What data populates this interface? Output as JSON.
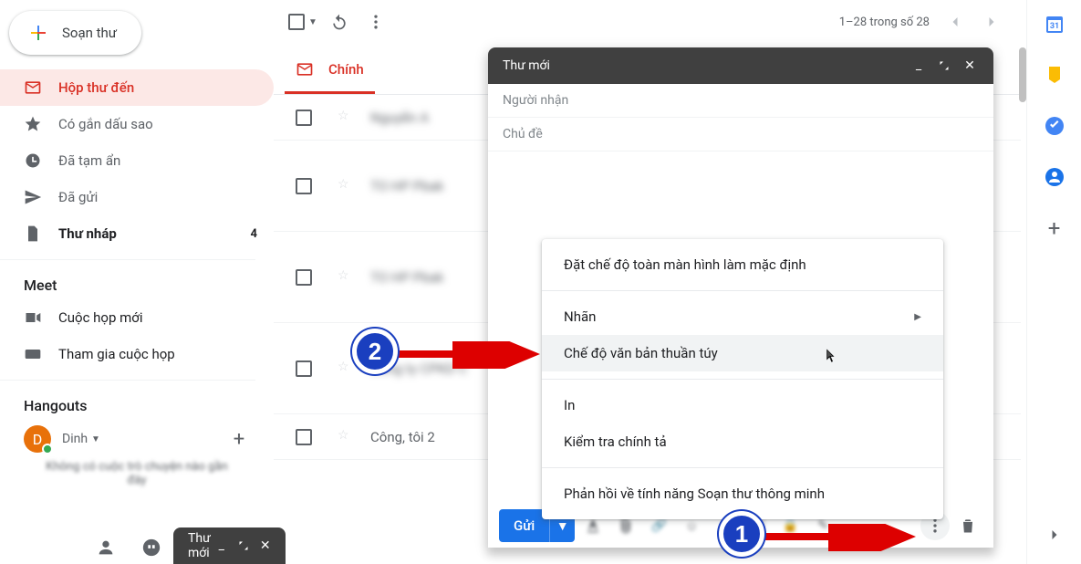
{
  "compose": {
    "label": "Soạn thư"
  },
  "nav": [
    {
      "icon": "inbox",
      "label": "Hộp thư đến",
      "active": true
    },
    {
      "icon": "star",
      "label": "Có gắn dấu sao"
    },
    {
      "icon": "snooze",
      "label": "Đã tạm ẩn"
    },
    {
      "icon": "sent",
      "label": "Đã gửi"
    },
    {
      "icon": "draft",
      "label": "Thư nháp",
      "bold": true,
      "count": "4"
    }
  ],
  "meet": {
    "title": "Meet",
    "items": [
      "Cuộc họp mới",
      "Tham gia cuộc họp"
    ]
  },
  "hangouts": {
    "title": "Hangouts",
    "user_initial": "D",
    "user_name": "Dinh",
    "msg": "Không có cuộc trò chuyện nào gần đây"
  },
  "tray": {
    "title": "Thư mới"
  },
  "pager": {
    "text": "1–28 trong số 28"
  },
  "tab": {
    "label": "Chính"
  },
  "emails": [
    {
      "sender": "Nguyễn A"
    },
    {
      "sender": "TO HP Pbak"
    },
    {
      "sender": "TO HP Pbak"
    },
    {
      "sender": "Công ty CPKD C"
    },
    {
      "sender": "Công, tôi 2"
    }
  ],
  "compose_window": {
    "title": "Thư mới",
    "recipients_ph": "Người nhận",
    "subject_ph": "Chủ đề",
    "send": "Gửi"
  },
  "menu": {
    "fullscreen": "Đặt chế độ toàn màn hình làm mặc định",
    "label": "Nhãn",
    "plaintext": "Chế độ văn bản thuần túy",
    "print": "In",
    "spellcheck": "Kiểm tra chính tả",
    "feedback": "Phản hồi về tính năng Soạn thư thông minh"
  },
  "callouts": {
    "one": "1",
    "two": "2"
  }
}
